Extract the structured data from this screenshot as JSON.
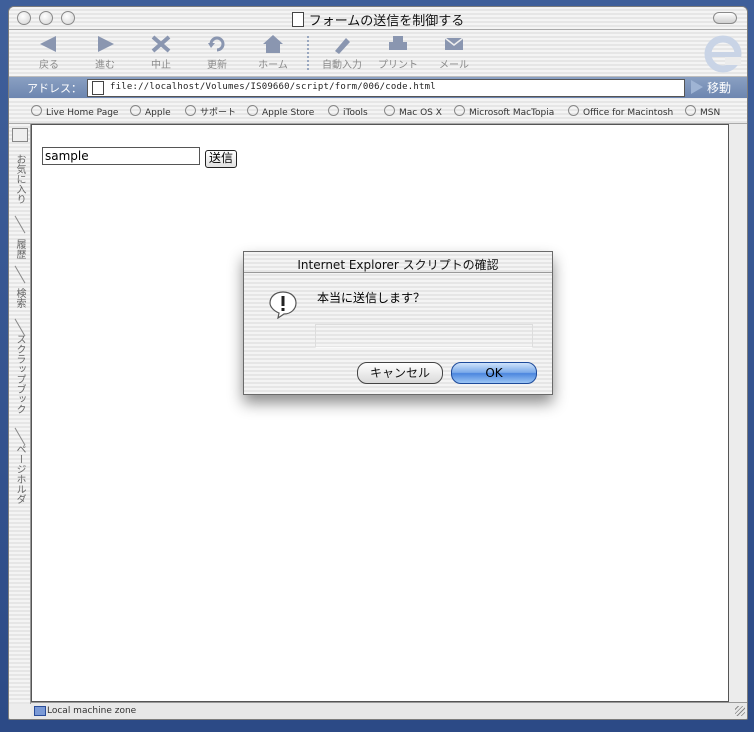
{
  "window": {
    "title": "フォームの送信を制御する"
  },
  "toolbar": {
    "items": [
      {
        "label": "戻る",
        "icon": "back-arrow"
      },
      {
        "label": "進む",
        "icon": "forward-arrow"
      },
      {
        "label": "中止",
        "icon": "stop-x"
      },
      {
        "label": "更新",
        "icon": "refresh"
      },
      {
        "label": "ホーム",
        "icon": "home"
      },
      {
        "label": "自動入力",
        "icon": "autofill"
      },
      {
        "label": "プリント",
        "icon": "print"
      },
      {
        "label": "メール",
        "icon": "mail"
      }
    ]
  },
  "address": {
    "label": "アドレス：",
    "url": "file://localhost/Volumes/IS09660/script/form/006/code.html",
    "go_label": "移動"
  },
  "favorites": [
    "Live Home Page",
    "Apple",
    "サポート",
    "Apple Store",
    "iTools",
    "Mac OS X",
    "Microsoft MacTopia",
    "Office for Macintosh",
    "MSN"
  ],
  "sidebar": {
    "tabs": [
      "お気に入り",
      "履歴",
      "検索",
      "スクラップブック",
      "ページホルダ"
    ]
  },
  "page": {
    "input_value": "sample",
    "send_label": "送信"
  },
  "status": {
    "zone": "Local machine zone"
  },
  "dialog": {
    "title": "Internet Explorer スクリプトの確認",
    "message": "本当に送信します？",
    "cancel_label": "キャンセル",
    "ok_label": "OK"
  },
  "colors": {
    "accent_blue": "#4b86de",
    "toolbar_icon": "#8a96b0",
    "address_bar": "#7a92b8",
    "desktop": "#345595"
  }
}
